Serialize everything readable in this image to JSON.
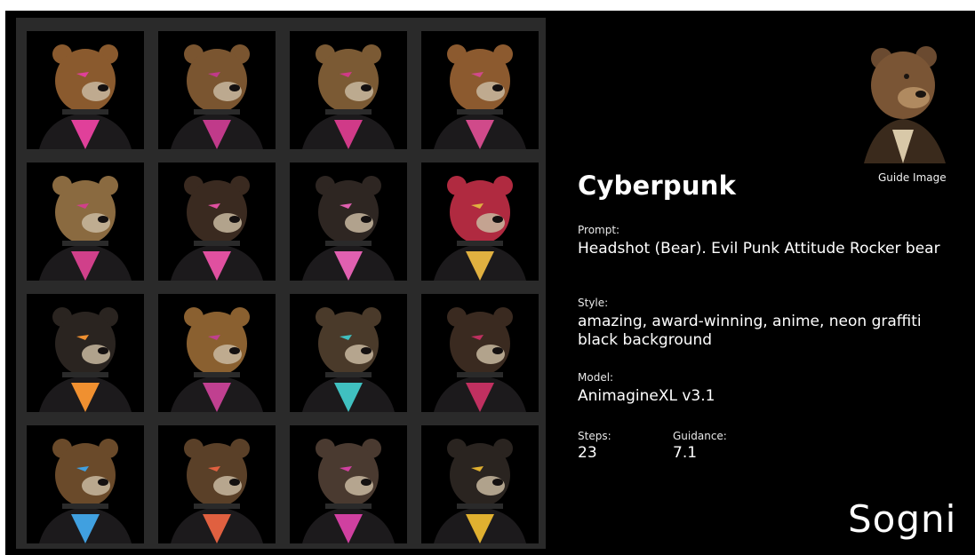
{
  "card": {
    "title": "Cyberpunk",
    "prompt_label": "Prompt:",
    "prompt_value": "Headshot (Bear). Evil Punk Attitude Rocker bear",
    "style_label": "Style:",
    "style_value": "amazing, award-winning, anime, neon graffiti black background",
    "model_label": "Model:",
    "model_value": "AnimagineXL v3.1",
    "steps_label": "Steps:",
    "steps_value": "23",
    "guidance_label": "Guidance:",
    "guidance_value": "7.1",
    "guide_image_label": "Guide Image",
    "brand": "Sogni"
  },
  "colors": {
    "background": "#000000",
    "grid_panel": "#2a2a2a",
    "text": "#ffffff"
  },
  "grid": {
    "rows": 4,
    "columns": 4,
    "images": [
      {
        "fur": "#8a5a2e",
        "accent": "#e0409a"
      },
      {
        "fur": "#7a5530",
        "accent": "#c03a8a"
      },
      {
        "fur": "#7b5a34",
        "accent": "#d03a88"
      },
      {
        "fur": "#8c5a2f",
        "accent": "#d04a8a"
      },
      {
        "fur": "#8a6a40",
        "accent": "#d0408a"
      },
      {
        "fur": "#3a2a20",
        "accent": "#e050a0"
      },
      {
        "fur": "#2e2622",
        "accent": "#e060b0"
      },
      {
        "fur": "#b02a40",
        "accent": "#e0b040"
      },
      {
        "fur": "#2a2420",
        "accent": "#f09030"
      },
      {
        "fur": "#8a6030",
        "accent": "#c04090"
      },
      {
        "fur": "#4a3a2a",
        "accent": "#40c0c0"
      },
      {
        "fur": "#3a2a20",
        "accent": "#c03060"
      },
      {
        "fur": "#6a4a2a",
        "accent": "#40a0e0"
      },
      {
        "fur": "#5a4028",
        "accent": "#e06040"
      },
      {
        "fur": "#4a3a30",
        "accent": "#d040a0"
      },
      {
        "fur": "#2a2420",
        "accent": "#e0b030"
      }
    ]
  }
}
